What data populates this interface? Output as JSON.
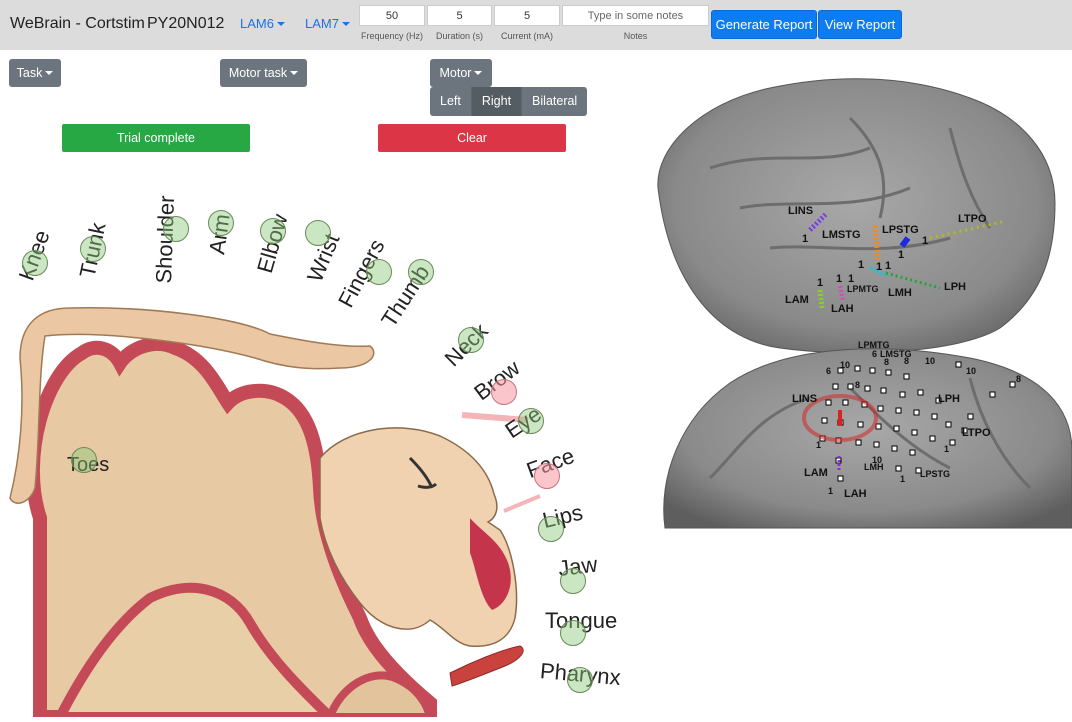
{
  "app": {
    "title": "WeBrain - Cortstim",
    "patient_id": "PY20N012"
  },
  "electrodes": {
    "first": "LAM6",
    "second": "LAM7"
  },
  "params": {
    "frequency": {
      "value": "50",
      "label": "Frequency (Hz)"
    },
    "duration": {
      "value": "5",
      "label": "Duration (s)"
    },
    "current": {
      "value": "5",
      "label": "Current (mA)"
    },
    "notes": {
      "placeholder": "Type in some notes",
      "label": "Notes"
    }
  },
  "buttons": {
    "generate_report": "Generate Report",
    "view_report": "View Report",
    "task": "Task",
    "motor_task": "Motor task",
    "motor": "Motor",
    "trial_complete": "Trial complete",
    "clear": "Clear"
  },
  "laterality": {
    "options": [
      "Left",
      "Right",
      "Bilateral"
    ],
    "selected": "Right"
  },
  "body_parts": [
    "Knee",
    "Trunk",
    "Shoulder",
    "Arm",
    "Elbow",
    "Wrist",
    "Fingers",
    "Thumb",
    "Neck",
    "Brow",
    "Eye",
    "Face",
    "Lips",
    "Jaw",
    "Tongue",
    "Pharynx",
    "Toes"
  ],
  "selected_body_parts": [
    "Brow",
    "Face"
  ],
  "brain_labels": {
    "lateral": [
      "LINS",
      "LMSTG",
      "LPSTG",
      "LTPO",
      "LAM",
      "LAH",
      "LPMTG",
      "LMH",
      "LPH"
    ],
    "medial": [
      "LPMTG",
      "LMSTG",
      "LINS",
      "LPH",
      "LTPO",
      "LAM",
      "LMH",
      "LPSTG",
      "LAH"
    ],
    "numbers": [
      "1",
      "6",
      "8",
      "10"
    ]
  },
  "colors": {
    "navbar": "#dcdcdc",
    "primary": "#0d7bf2",
    "secondary": "#6c757d",
    "success": "#28a745",
    "danger": "#dc3545",
    "hotspot": "#8cc878",
    "hotspot_selected": "#f596a0"
  }
}
